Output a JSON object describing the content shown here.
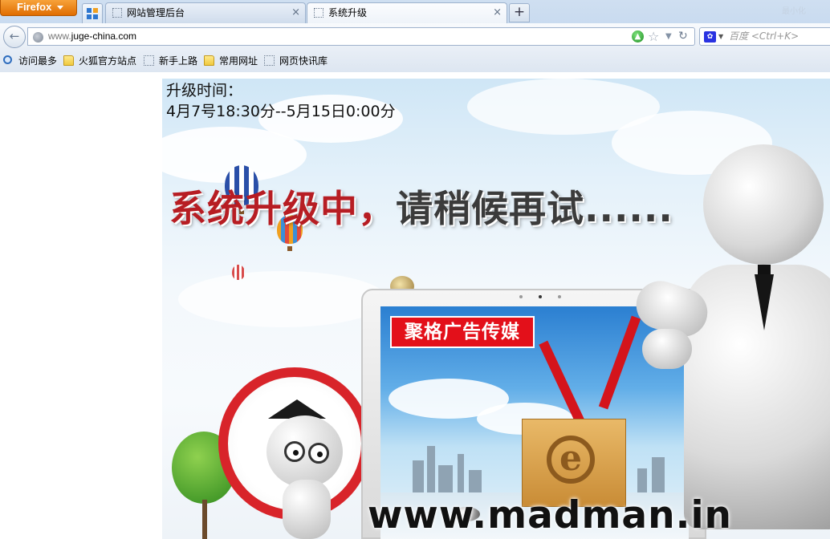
{
  "browser": {
    "menu_button_label": "Firefox",
    "tabs": [
      {
        "label": "网站管理后台",
        "active": false
      },
      {
        "label": "系统升级",
        "active": true
      }
    ],
    "new_tab_symbol": "+",
    "tab_close_symbol": "×",
    "window_controls_text": "最小化",
    "url": {
      "prefix": "www.",
      "domain": "juge-china.com"
    },
    "search": {
      "engine_icon": "baidu-paw-icon",
      "placeholder": "百度 <Ctrl+K>"
    },
    "bookmarks": [
      {
        "label": "访问最多",
        "icon": "most-visited-icon"
      },
      {
        "label": "火狐官方站点",
        "icon": "folder-icon"
      },
      {
        "label": "新手上路",
        "icon": "page-icon"
      },
      {
        "label": "常用网址",
        "icon": "folder-icon"
      },
      {
        "label": "网页快讯库",
        "icon": "page-icon"
      }
    ]
  },
  "page": {
    "upgrade_time_label": "升级时间：",
    "upgrade_time_value": "4月7号18:30分--5月15日0:00分",
    "headline_red": "系统升级中，",
    "headline_grey": "请稍候再试......",
    "brand_box": "聚格广告传媒",
    "box_letter": "e",
    "watermark": "www.madman.in",
    "colors": {
      "headline_red": "#b71d23",
      "brand_red": "#e3101a",
      "firefox_orange": "#e06d00"
    }
  }
}
